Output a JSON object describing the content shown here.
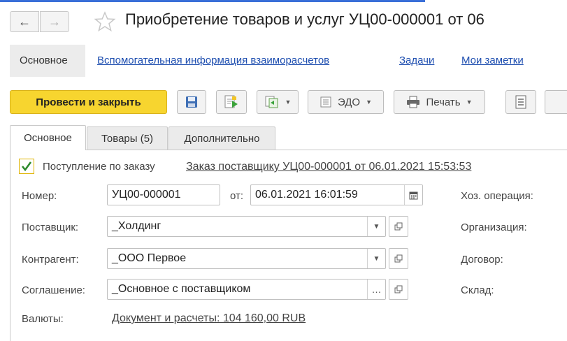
{
  "window": {
    "title": "Приобретение товаров и услуг УЦ00-000001 от 06"
  },
  "sections": {
    "main": "Основное",
    "links": [
      "Вспомогательная информация взаиморасчетов",
      "Задачи",
      "Мои заметки"
    ]
  },
  "toolbar": {
    "post_close_label": "Провести и закрыть",
    "edo_label": "ЭДО",
    "print_label": "Печать"
  },
  "tabs": [
    {
      "label": "Основное",
      "active": true
    },
    {
      "label": "Товары (5)",
      "active": false
    },
    {
      "label": "Дополнительно",
      "active": false
    }
  ],
  "form": {
    "order_checkbox_label": "Поступление по заказу",
    "order_checked": true,
    "order_link": "Заказ поставщику УЦ00-000001 от 06.01.2021 15:53:53",
    "number_label": "Номер:",
    "number_value": "УЦ00-000001",
    "date_label": "от:",
    "date_value": "06.01.2021 16:01:59",
    "supplier_label": "Поставщик:",
    "supplier_value": "_Холдинг",
    "counterparty_label": "Контрагент:",
    "counterparty_value": "_ООО Первое",
    "agreement_label": "Соглашение:",
    "agreement_value": "_Основное с поставщиком",
    "currency_label": "Валюты:",
    "currency_link": "Документ и расчеты: 104 160,00 RUB",
    "right_labels": [
      "Хоз. операция:",
      "Организация:",
      "Договор:",
      "Склад:"
    ]
  },
  "icons": {
    "star": "star-icon",
    "save": "floppy-disk-icon",
    "post": "post-document-icon",
    "create_based": "create-based-on-icon",
    "edo": "edo-document-icon",
    "print": "printer-icon",
    "report": "report-list-icon",
    "calendar": "calendar-icon",
    "open": "open-object-icon"
  },
  "colors": {
    "accent_yellow": "#f7d52f",
    "link_blue": "#1f4fb0",
    "top_line": "#3a6fd8"
  }
}
